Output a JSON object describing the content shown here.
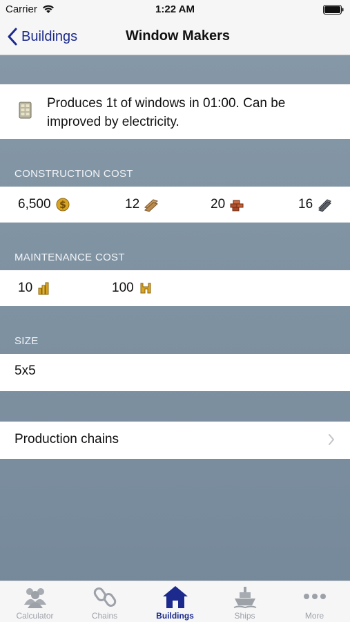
{
  "status_bar": {
    "carrier": "Carrier",
    "time": "1:22 AM"
  },
  "nav": {
    "back_label": "Buildings",
    "title": "Window Makers"
  },
  "description": {
    "text": "Produces 1t of windows in 01:00. Can be improved by electricity.",
    "icon": "windows-good-icon"
  },
  "construction": {
    "header": "CONSTRUCTION COST",
    "items": [
      {
        "value": "6,500",
        "icon": "coin-icon"
      },
      {
        "value": "12",
        "icon": "timber-icon"
      },
      {
        "value": "20",
        "icon": "bricks-icon"
      },
      {
        "value": "16",
        "icon": "steel-beam-icon"
      }
    ]
  },
  "maintenance": {
    "header": "MAINTENANCE COST",
    "items": [
      {
        "value": "10",
        "icon": "coin-stack-icon"
      },
      {
        "value": "100",
        "icon": "workforce-icon"
      }
    ]
  },
  "size": {
    "header": "SIZE",
    "value": "5x5"
  },
  "production_chains": {
    "label": "Production chains"
  },
  "tabs": [
    {
      "label": "Calculator",
      "icon": "people-icon",
      "active": false
    },
    {
      "label": "Chains",
      "icon": "chain-icon",
      "active": false
    },
    {
      "label": "Buildings",
      "icon": "house-icon",
      "active": true
    },
    {
      "label": "Ships",
      "icon": "ship-icon",
      "active": false
    },
    {
      "label": "More",
      "icon": "more-icon",
      "active": false
    }
  ],
  "colors": {
    "accent": "#1b2a8c",
    "background": "#8193a3",
    "cell": "#ffffff",
    "inactive_tab": "#9da1a8"
  }
}
